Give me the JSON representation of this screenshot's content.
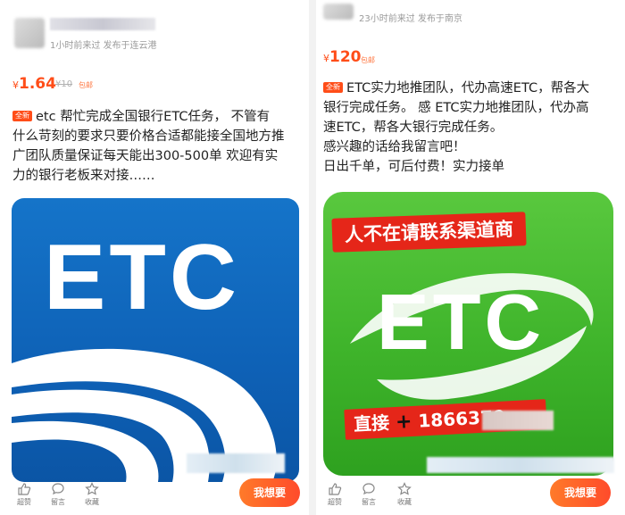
{
  "left": {
    "time_location": "1小时前来过  发布于连云港",
    "price_symbol": "¥",
    "price": "1.64",
    "original_price": "¥10",
    "shipping_tag": "包邮",
    "new_tag": "全新",
    "description_lines": [
      "etc 帮忙完成全国银行ETC任务，  不管有",
      "什么苛刻的要求只要价格合适都能接全国地方推",
      "广团队质量保证每天能出300-500单  欢迎有实",
      "力的银行老板来对接……"
    ],
    "image": {
      "logo_text": "ETC"
    },
    "actions": {
      "like_label": "超赞",
      "comment_label": "留言",
      "favorite_label": "收藏"
    },
    "want_button": "我想要"
  },
  "right": {
    "time_location": "23小时前来过  发布于南京",
    "price_symbol": "¥",
    "price": "120",
    "shipping_tag": "包邮",
    "new_tag": "全新",
    "description_lines": [
      "ETC实力地推团队，代办高速ETC，帮各大",
      "银行完成任务。 感 ETC实力地推团队，代办高",
      "速ETC，帮各大银行完成任务。",
      "感兴趣的话给我留言吧！",
      "日出千单，可后付费！实力接单"
    ],
    "image": {
      "banner_text": "人不在请联系渠道商",
      "logo_text": "ETC",
      "phone_prefix": "直接",
      "phone_plus": "+",
      "phone_number": "1866370"
    },
    "actions": {
      "like_label": "超赞",
      "comment_label": "留言",
      "favorite_label": "收藏"
    },
    "want_button": "我想要"
  },
  "colors": {
    "accent": "#ff4d18",
    "etc_blue": "#0e61b6",
    "etc_green": "#3fb42b",
    "banner_red": "#e52619"
  }
}
